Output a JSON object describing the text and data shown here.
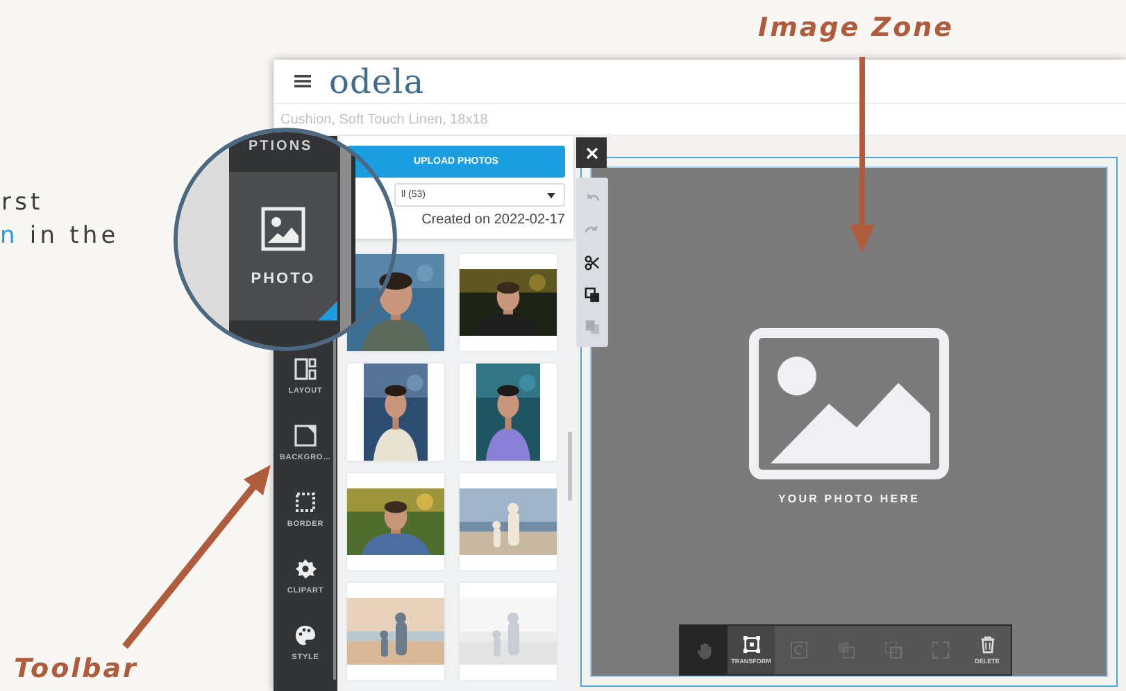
{
  "intro": [
    [
      {
        "text": "rst",
        "highlight": false
      }
    ],
    [
      {
        "text": "n",
        "highlight": true
      },
      {
        "text": " in the",
        "highlight": false
      }
    ]
  ],
  "callouts": [
    {
      "text": "Image Zone",
      "kind": "image_zone"
    },
    {
      "text": "Toolbar",
      "kind": "toolbar"
    }
  ],
  "app": {
    "logo": "odela",
    "product": "Cushion, Soft Touch Linen, 18x18"
  },
  "magnifier": {
    "header": "PTIONS",
    "item": {
      "label": "PHOTO",
      "selected": true
    }
  },
  "toolbar": [
    {
      "kind": "layout",
      "label": "LAYOUT"
    },
    {
      "kind": "background",
      "label": "BACKGRO…"
    },
    {
      "kind": "border",
      "label": "BORDER"
    },
    {
      "kind": "clipart",
      "label": "CLIPART"
    },
    {
      "kind": "style",
      "label": "STYLE"
    }
  ],
  "panel": {
    "upload_button": "UPLOAD PHOTOS",
    "album_select": "ll (53)",
    "created": "Created on 2022-02-17"
  },
  "edit_tools": [
    {
      "kind": "undo",
      "disabled": true
    },
    {
      "kind": "redo",
      "disabled": true
    },
    {
      "kind": "cut",
      "disabled": false
    },
    {
      "kind": "copy",
      "disabled": false
    },
    {
      "kind": "paste",
      "disabled": true
    }
  ],
  "canvas": {
    "placeholder": "YOUR PHOTO HERE"
  },
  "canvas_tools": [
    {
      "kind": "pan",
      "selected": false,
      "disabled": false
    },
    {
      "kind": "transform",
      "label": "TRANSFORM",
      "selected": true,
      "disabled": false
    },
    {
      "kind": "rotate",
      "selected": false,
      "disabled": true
    },
    {
      "kind": "front",
      "selected": false,
      "disabled": true
    },
    {
      "kind": "back",
      "selected": false,
      "disabled": true
    },
    {
      "kind": "expand",
      "selected": false,
      "disabled": true
    },
    {
      "kind": "delete",
      "label": "DELETE",
      "selected": false,
      "disabled": false
    }
  ]
}
